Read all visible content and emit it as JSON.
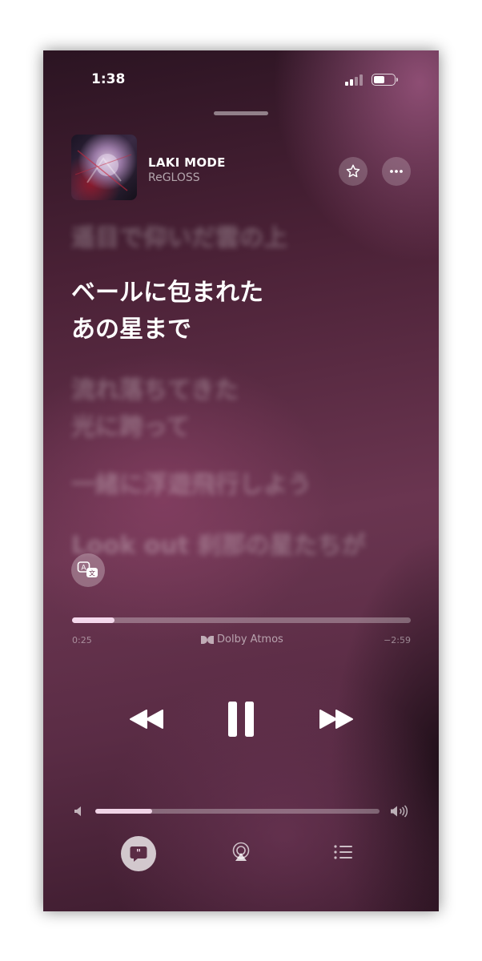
{
  "status_bar": {
    "time": "1:38",
    "signal_icon": "cellular-signal-icon",
    "battery_icon": "battery-icon"
  },
  "now_playing": {
    "title": "LAKI MODE",
    "artist": "ReGLOSS",
    "artwork": "album-artwork"
  },
  "header_buttons": {
    "favorite_icon": "star-icon",
    "more_icon": "ellipsis-icon"
  },
  "lyrics": {
    "previous": [
      "遥目で仰いだ雲の上"
    ],
    "current": [
      "ベールに包まれた",
      "あの星まで"
    ],
    "upcoming": [
      [
        "流れ落ちてきた",
        "光に跨って"
      ],
      [
        "一緒に浮遊飛行しよう"
      ],
      [
        "Look out 刹那の星たちが"
      ]
    ]
  },
  "translate_button": {
    "icon": "translate-icon"
  },
  "playback": {
    "progress": 0.125,
    "elapsed": "0:25",
    "remaining": "−2:59",
    "badge": "Dolby Atmos"
  },
  "controls": {
    "previous_icon": "rewind-icon",
    "play_pause_icon": "pause-icon",
    "next_icon": "fast-forward-icon"
  },
  "volume": {
    "level": 0.2,
    "min_icon": "speaker-low-icon",
    "max_icon": "speaker-high-icon"
  },
  "bottom_bar": {
    "lyrics_icon": "lyrics-quote-icon",
    "airplay_icon": "airplay-icon",
    "queue_icon": "queue-list-icon"
  },
  "colors": {
    "accent_progress": "#f4d8ec",
    "background_top": "#2b1422",
    "background_mid": "#6a3550"
  }
}
